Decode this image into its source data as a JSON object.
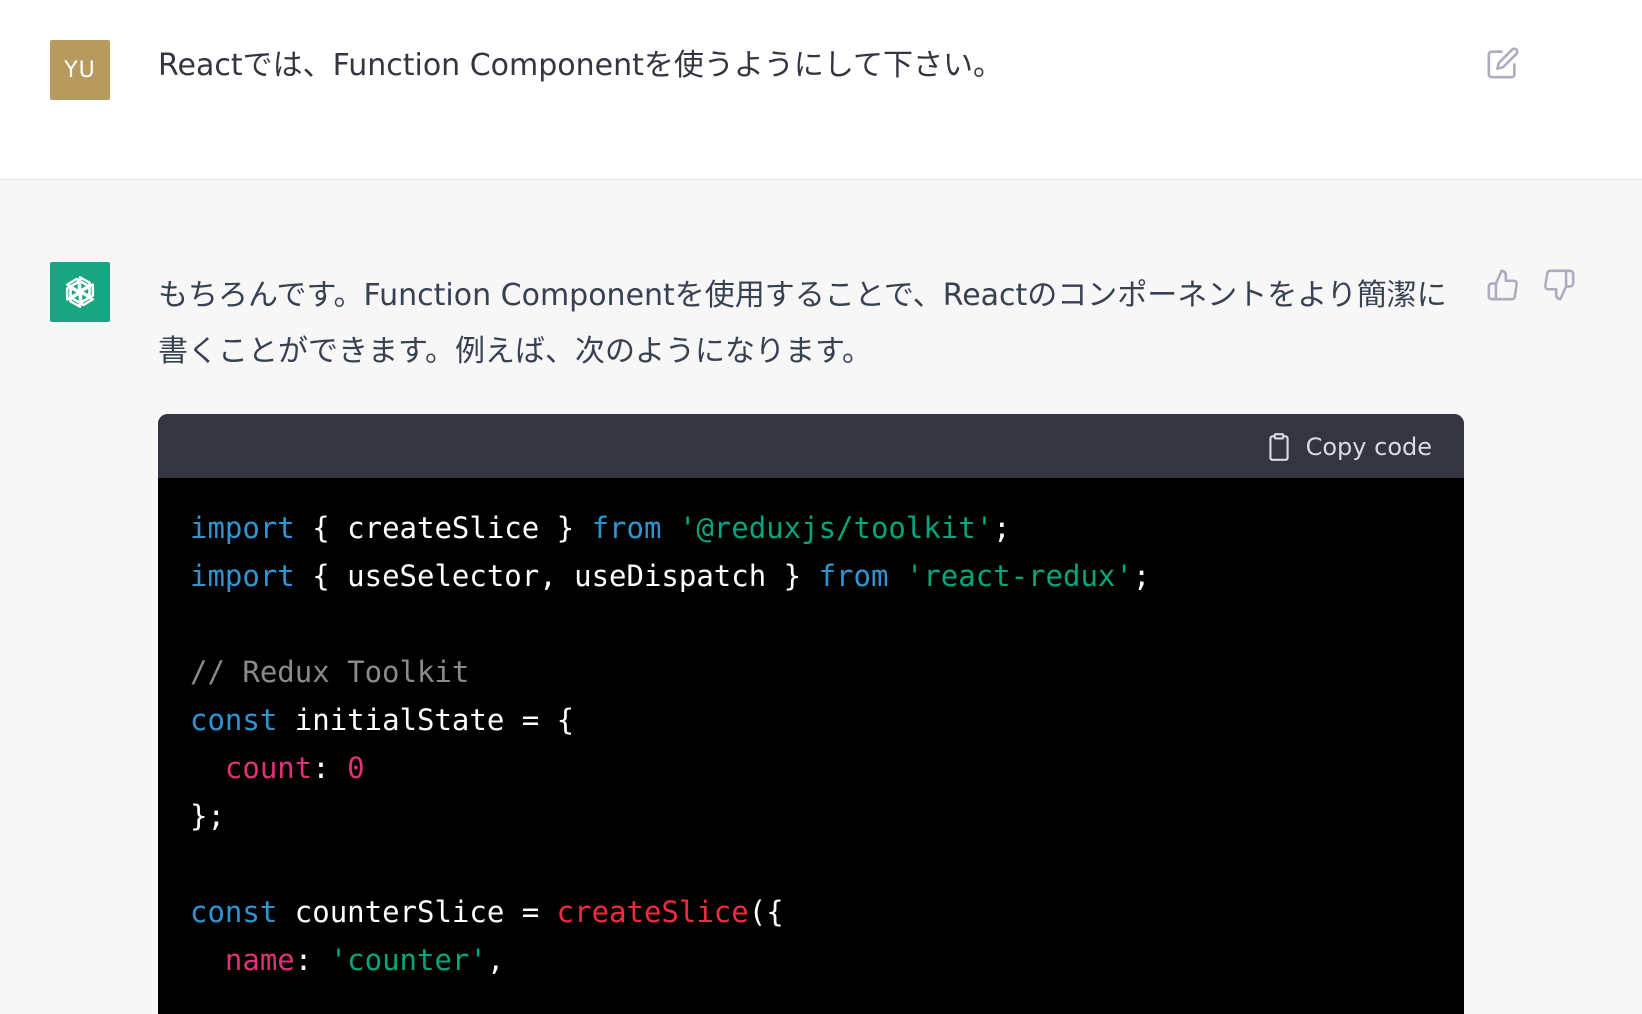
{
  "user": {
    "avatar_initials": "YU",
    "message": "Reactでは、Function Componentを使うようにして下さい。"
  },
  "assistant": {
    "message": "もちろんです。Function Componentを使用することで、Reactのコンポーネントをより簡潔に書くことができます。例えば、次のようになります。",
    "code_header": {
      "copy_label": "Copy code"
    },
    "code": {
      "line1": {
        "kw1": "import",
        "mid": " { createSlice } ",
        "kw2": "from",
        "str": "'@reduxjs/toolkit'",
        "end": ";"
      },
      "line2": {
        "kw1": "import",
        "mid": " { useSelector, useDispatch } ",
        "kw2": "from",
        "str": "'react-redux'",
        "end": ";"
      },
      "line4": {
        "comment": "// Redux Toolkit"
      },
      "line5": {
        "kw": "const",
        "rest": " initialState = {"
      },
      "line6": {
        "indent": "  ",
        "prop": "count",
        "sep": ": ",
        "num": "0"
      },
      "line7": {
        "text": "};"
      },
      "line9": {
        "kw": "const",
        "mid": " counterSlice = ",
        "fn": "createSlice",
        "end": "({"
      },
      "line10": {
        "indent": "  ",
        "prop": "name",
        "sep": ": ",
        "str": "'counter'",
        "end": ","
      }
    }
  },
  "icons": {
    "edit": "edit-icon",
    "thumbs_up": "thumbs-up-icon",
    "thumbs_down": "thumbs-down-icon",
    "clipboard": "clipboard-icon",
    "openai_logo": "openai-logo-icon"
  },
  "colors": {
    "user_avatar": "#b79a5d",
    "bot_avatar": "#19a57f",
    "code_bg": "#000000",
    "code_header_bg": "#343541",
    "keyword": "#2e95d3",
    "string": "#00a67d",
    "property": "#df3079",
    "function": "#f22c3d",
    "comment": "#8a8a8a"
  }
}
